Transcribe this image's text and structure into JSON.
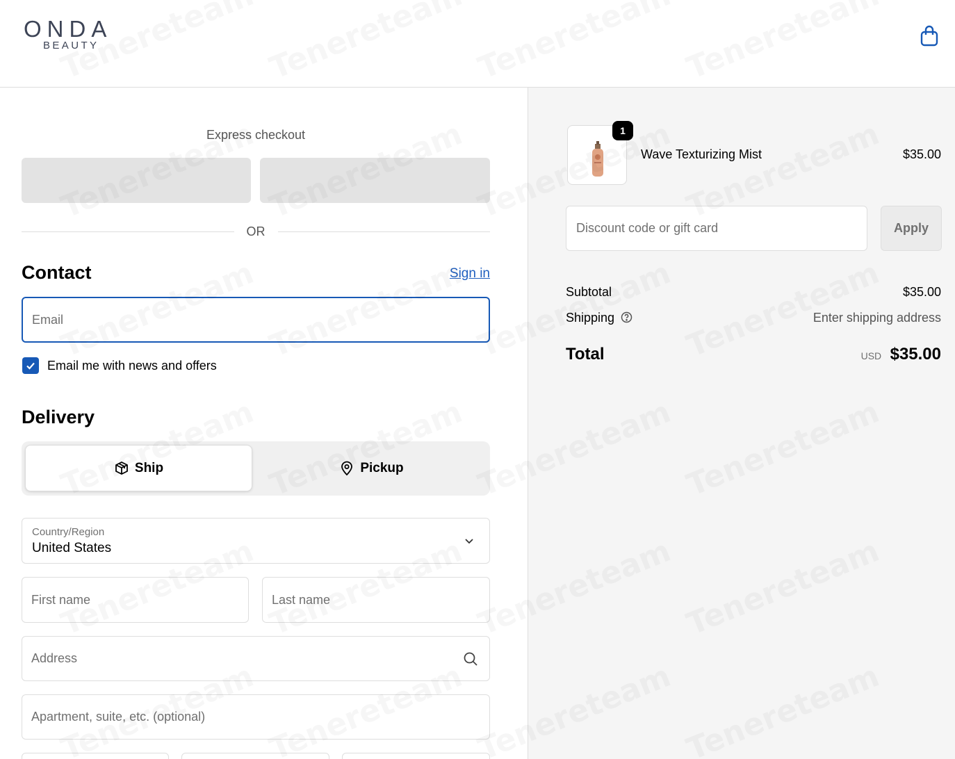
{
  "brand": {
    "name": "ONDA",
    "subtitle": "BEAUTY"
  },
  "header": {
    "cart_icon": "shopping-bag-icon"
  },
  "express": {
    "title": "Express checkout",
    "separator": "OR"
  },
  "contact": {
    "title": "Contact",
    "sign_in": "Sign in",
    "email_placeholder": "Email",
    "marketing_label": "Email me with news and offers",
    "marketing_checked": true
  },
  "delivery": {
    "title": "Delivery",
    "options": [
      {
        "label": "Ship",
        "icon": "package-icon",
        "selected": true
      },
      {
        "label": "Pickup",
        "icon": "map-pin-icon",
        "selected": false
      }
    ],
    "country_label": "Country/Region",
    "country_value": "United States",
    "first_name_placeholder": "First name",
    "last_name_placeholder": "Last name",
    "address_placeholder": "Address",
    "apartment_placeholder": "Apartment, suite, etc. (optional)"
  },
  "summary": {
    "item": {
      "name": "Wave Texturizing Mist",
      "price": "$35.00",
      "quantity": "1"
    },
    "discount_placeholder": "Discount code or gift card",
    "apply_label": "Apply",
    "subtotal_label": "Subtotal",
    "subtotal_value": "$35.00",
    "shipping_label": "Shipping",
    "shipping_value": "Enter shipping address",
    "total_label": "Total",
    "currency": "USD",
    "total_value": "$35.00"
  },
  "watermark": "Tenereteam",
  "colors": {
    "accent": "#1759b6",
    "link": "#1f5fbf",
    "panel": "#f5f5f5"
  }
}
